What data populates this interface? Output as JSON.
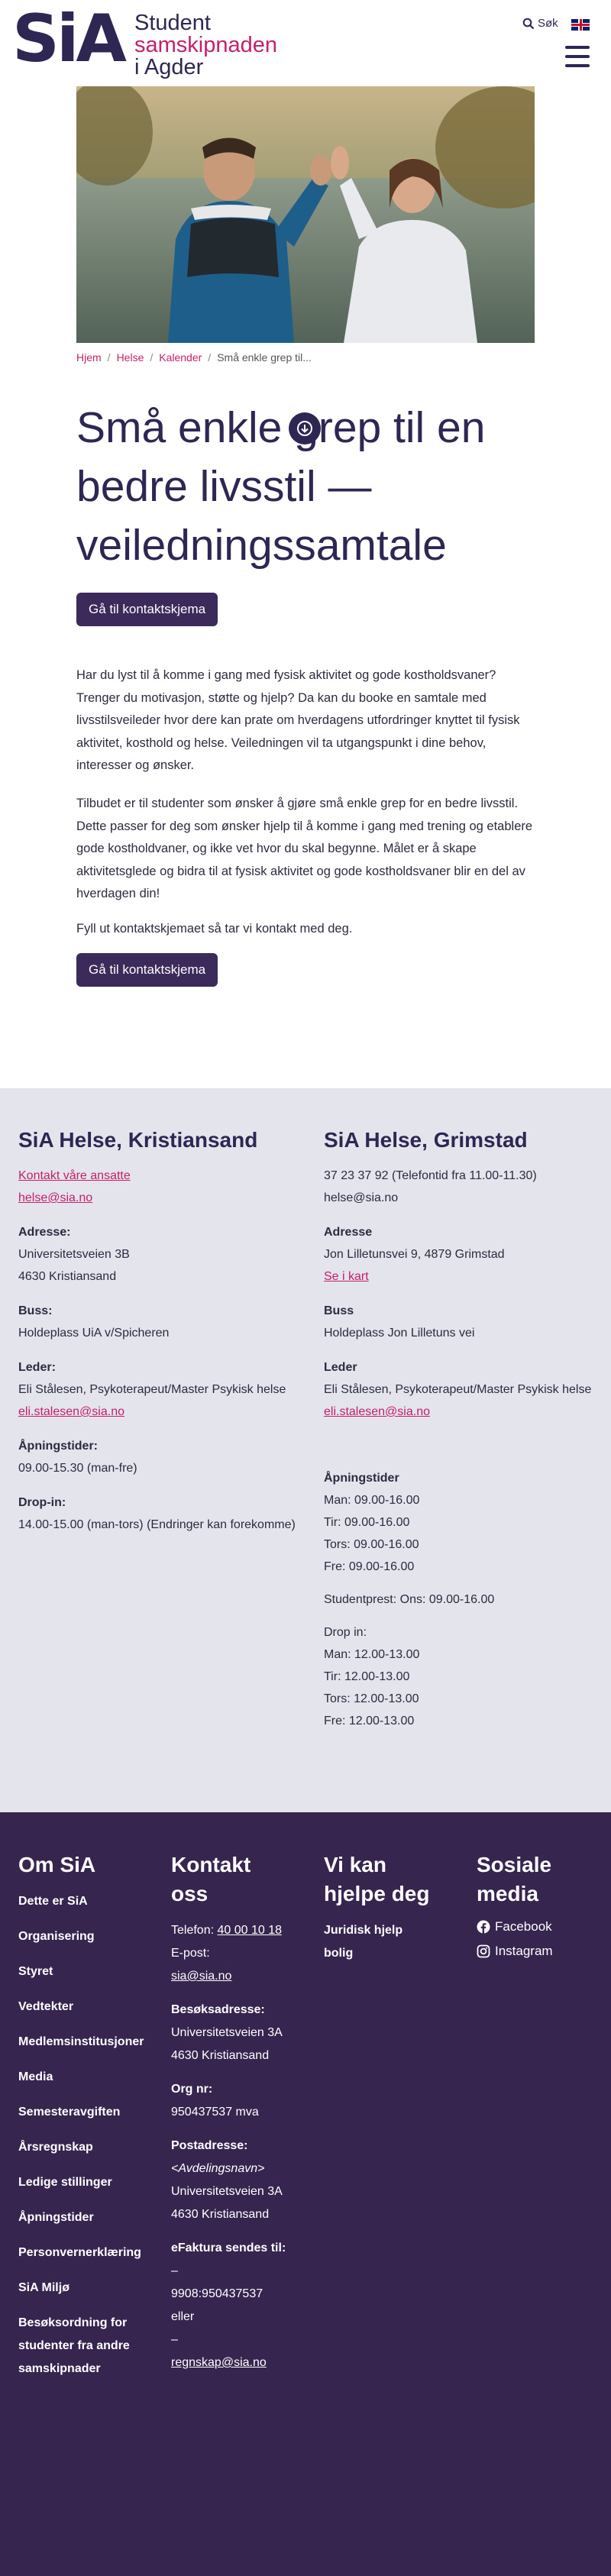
{
  "header": {
    "logo_mark": "SiA",
    "logo_line1": "Student",
    "logo_line2": "samskipnaden",
    "logo_line3": "i Agder",
    "search_label": "Søk",
    "language_flag": "english-flag-icon"
  },
  "breadcrumb": {
    "items": [
      "Hjem",
      "Helse",
      "Kalender"
    ],
    "current": "Små enkle grep til..."
  },
  "page": {
    "title": "Små enkle grep til en bedre livsstil — veiledningssamtale",
    "contact_button": "Gå til kontaktskjema",
    "paragraphs": [
      "Har du lyst til å komme i gang med fysisk aktivitet og gode kostholdsvaner? Trenger du motivasjon, støtte og hjelp? Da kan du booke en samtale med livsstilsveileder hvor dere kan prate om hverdagens utfordringer knyttet til fysisk aktivitet, kosthold og helse. Veiledningen vil ta utgangspunkt i dine behov, interesser og ønsker.",
      "Tilbudet er til studenter som ønsker å gjøre små enkle grep for en bedre livsstil. Dette passer for deg som ønsker hjelp til å komme i gang med trening og etablere gode kostholdvaner, og ikke vet hvor du skal begynne. Målet er å skape aktivitetsglede og bidra til at fysisk aktivitet og gode kostholdsvaner blir en del av hverdagen din!",
      "Fyll ut kontaktskjemaet så tar vi kontakt med deg."
    ]
  },
  "kristiansand": {
    "title": "SiA Helse, Kristiansand",
    "contact_link": "Kontakt våre ansatte",
    "email": "helse@sia.no",
    "address_label": "Adresse:",
    "address_1": "Universitetsveien 3B",
    "address_2": "4630 Kristiansand",
    "bus_label": "Buss:",
    "bus": "Holdeplass UiA v/Spicheren",
    "leader_label": "Leder:",
    "leader": "Eli Stålesen, Psykoterapeut/Master Psykisk helse",
    "leader_email": "eli.stalesen@sia.no",
    "hours_label": "Åpningstider:",
    "hours": "09.00-15.30 (man-fre)",
    "dropin_label": "Drop-in:",
    "dropin": "14.00-15.00 (man-tors) (Endringer kan forekomme)"
  },
  "grimstad": {
    "title": "SiA Helse, Grimstad",
    "phone": "37 23 37 92 (Telefontid fra 11.00-11.30)",
    "email": "helse@sia.no",
    "address_label": "Adresse",
    "address": "Jon Lilletunsvei 9, 4879 Grimstad",
    "map_link": "Se i kart",
    "bus_label": "Buss",
    "bus": "Holdeplass Jon Lilletuns vei",
    "leader_label": "Leder",
    "leader": "Eli Stålesen, Psykoterapeut/Master Psykisk helse",
    "leader_email": "eli.stalesen@sia.no",
    "hours_label": "Åpningstider",
    "hours": [
      "Man: 09.00-16.00",
      "Tir: 09.00-16.00",
      "Tors: 09.00-16.00",
      "Fre: 09.00-16.00"
    ],
    "studentprest": "Studentprest: Ons: 09.00-16.00",
    "dropin_label": "Drop in:",
    "dropin": [
      "Man: 12.00-13.00",
      "Tir: 12.00-13.00",
      "Tors: 12.00-13.00",
      "Fre: 12.00-13.00"
    ]
  },
  "footer": {
    "om_title": "Om SiA",
    "om_links": [
      "Dette er SiA",
      "Organisering",
      "Styret",
      "Vedtekter",
      "Medlemsinstitusjoner",
      "Media",
      "Semesteravgiften",
      "Årsregnskap",
      "Ledige stillinger",
      "Åpningstider",
      "Personvernerklæring",
      "SiA Miljø",
      "Besøksordning for studenter fra andre samskipnader"
    ],
    "kontakt_title": "Kontakt oss",
    "phone_label": "Telefon:",
    "phone": "40 00 10 18",
    "email_label": "E-post:",
    "email": "sia@sia.no",
    "visit_label": "Besøksadresse:",
    "visit_1": "Universitetsveien 3A",
    "visit_2": "4630 Kristiansand",
    "org_label": "Org nr:",
    "org": "950437537 mva",
    "post_label": "Postadresse:",
    "post_0": "<Avdelingsnavn>",
    "post_1": "Universitetsveien 3A",
    "post_2": "4630 Kristiansand",
    "efaktura_label": "eFaktura sendes til:",
    "efaktura_1": "9908:950437537",
    "efaktura_or": "eller",
    "efaktura_2": "regnskap@sia.no",
    "hjelp_title": "Vi kan hjelpe deg",
    "hjelp_links": [
      "Juridisk hjelp bolig"
    ],
    "social_title": "Sosiale media",
    "social": [
      "Facebook",
      "Instagram"
    ]
  }
}
